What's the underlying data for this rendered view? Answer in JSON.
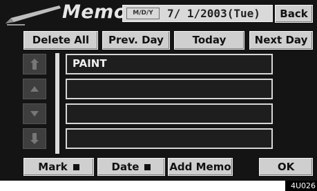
{
  "header": {
    "title": "Memo",
    "date_format": "M/D/Y",
    "date_value": "7/ 1/2003(Tue)",
    "back_label": "Back"
  },
  "nav": {
    "delete_all": "Delete All",
    "prev_day": "Prev. Day",
    "today": "Today",
    "next_day": "Next Day"
  },
  "memos": [
    "PAINT",
    "",
    "",
    ""
  ],
  "footer": {
    "mark": "Mark",
    "date": "Date",
    "add_memo": "Add Memo",
    "ok": "OK"
  },
  "image_code": "4U026",
  "icons": [
    "pen-icon",
    "page-up-icon",
    "line-up-icon",
    "line-down-icon",
    "page-down-icon"
  ]
}
